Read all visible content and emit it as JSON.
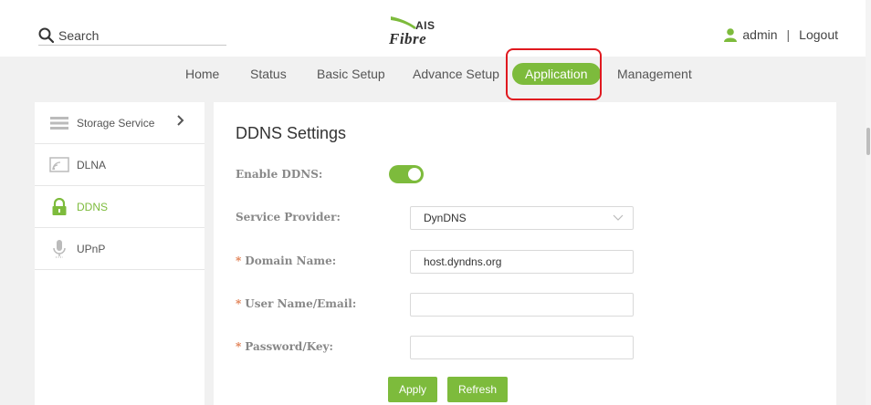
{
  "header": {
    "search_placeholder": "Search",
    "logo": {
      "top": "AIS",
      "bottom": "Fibre"
    },
    "user": "admin",
    "separator": "|",
    "logout": "Logout"
  },
  "nav": {
    "items": [
      {
        "label": "Home"
      },
      {
        "label": "Status"
      },
      {
        "label": "Basic Setup"
      },
      {
        "label": "Advance Setup"
      },
      {
        "label": "Application",
        "active": true
      },
      {
        "label": "Management"
      }
    ]
  },
  "sidebar": {
    "items": [
      {
        "label": "Storage Service",
        "icon": "storage-icon"
      },
      {
        "label": "DLNA",
        "icon": "dlna-icon"
      },
      {
        "label": "DDNS",
        "icon": "lock-icon",
        "active": true
      },
      {
        "label": "UPnP",
        "icon": "microphone-icon"
      }
    ]
  },
  "panel": {
    "title": "DDNS Settings",
    "fields": {
      "enable_ddns": {
        "label": "Enable DDNS:",
        "value": "on"
      },
      "service_provider": {
        "label": "Service Provider:",
        "value": "DynDNS"
      },
      "domain_name": {
        "label": "Domain Name:",
        "value": "host.dyndns.org",
        "required": "*"
      },
      "user_name": {
        "label": "User Name/Email:",
        "value": "",
        "required": "*"
      },
      "password": {
        "label": "Password/Key:",
        "value": "",
        "required": "*"
      }
    },
    "buttons": {
      "apply": "Apply",
      "refresh": "Refresh"
    }
  },
  "colors": {
    "accent": "#7dbb3c",
    "highlight": "#e0191f",
    "background": "#f1f1f1"
  }
}
